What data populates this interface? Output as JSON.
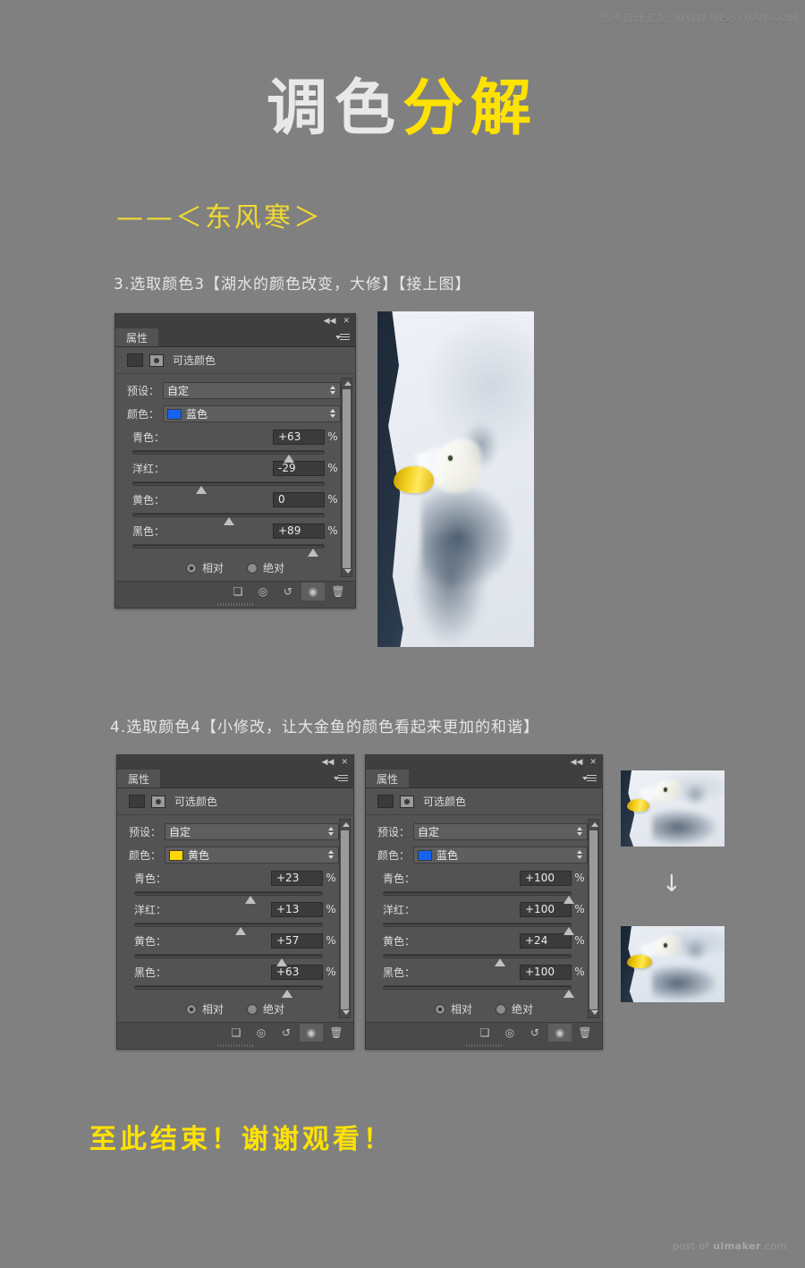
{
  "watermarks": {
    "top_cn": "思缘设计论坛",
    "top_en": "WWW.MISSYUAN.COM",
    "bottom_prefix": "post of ",
    "bottom_brand": "uimaker",
    "bottom_suffix": ".com"
  },
  "title": {
    "white_part": "调色",
    "yellow_part": "分解",
    "subtitle": "——＜东风寒＞"
  },
  "sections": [
    {
      "caption": "3.选取颜色3【湖水的颜色改变，大修】【接上图】"
    },
    {
      "caption": "4.选取颜色4【小修改，让大金鱼的颜色看起来更加的和谐】"
    }
  ],
  "closing_text": "至此结束！谢谢观看！",
  "panel_common": {
    "tab_label": "属性",
    "adjustment_name": "可选颜色",
    "preset_label": "预设：",
    "preset_value": "自定",
    "color_label": "颜色：",
    "percent_sign": "%",
    "relative_label": "相对",
    "absolute_label": "绝对",
    "method_selected": "相对",
    "slider_labels": [
      "青色：",
      "洋红：",
      "黄色：",
      "黑色："
    ],
    "footer_icons": [
      "clip-to-layer-icon",
      "view-previous-state-icon",
      "reset-icon",
      "toggle-visibility-icon",
      "delete-icon"
    ],
    "titlebar_icons": [
      "collapse-icon",
      "close-icon"
    ]
  },
  "panels": [
    {
      "id": "panel-selective-color-blue-1",
      "color_value": "蓝色",
      "color_swatch": "#1464f0",
      "sliders": [
        {
          "label": "青色：",
          "value": "+63",
          "pct": 63
        },
        {
          "label": "洋红：",
          "value": "-29",
          "pct": -29
        },
        {
          "label": "黄色：",
          "value": "0",
          "pct": 0
        },
        {
          "label": "黑色：",
          "value": "+89",
          "pct": 89
        }
      ]
    },
    {
      "id": "panel-selective-color-yellow",
      "color_value": "黄色",
      "color_swatch": "#ffd800",
      "sliders": [
        {
          "label": "青色：",
          "value": "+23",
          "pct": 23
        },
        {
          "label": "洋红：",
          "value": "+13",
          "pct": 13
        },
        {
          "label": "黄色：",
          "value": "+57",
          "pct": 57
        },
        {
          "label": "黑色：",
          "value": "+63",
          "pct": 63
        }
      ]
    },
    {
      "id": "panel-selective-color-blue-2",
      "color_value": "蓝色",
      "color_swatch": "#1464f0",
      "sliders": [
        {
          "label": "青色：",
          "value": "+100",
          "pct": 100
        },
        {
          "label": "洋红：",
          "value": "+100",
          "pct": 100
        },
        {
          "label": "黄色：",
          "value": "+24",
          "pct": 24
        },
        {
          "label": "黑色：",
          "value": "+100",
          "pct": 100
        }
      ]
    }
  ],
  "photos": {
    "main_alt": "goldfish-in-water-large",
    "thumb_before_alt": "goldfish-before-thumbnail",
    "thumb_after_alt": "goldfish-after-thumbnail",
    "arrow_glyph": "↓"
  },
  "colors": {
    "background": "#808080",
    "accent_yellow": "#ffe200",
    "subtitle_yellow": "#f2d930",
    "title_white": "#e8e8e8",
    "panel_bg": "#535353",
    "panel_header": "#3f3f3f"
  }
}
